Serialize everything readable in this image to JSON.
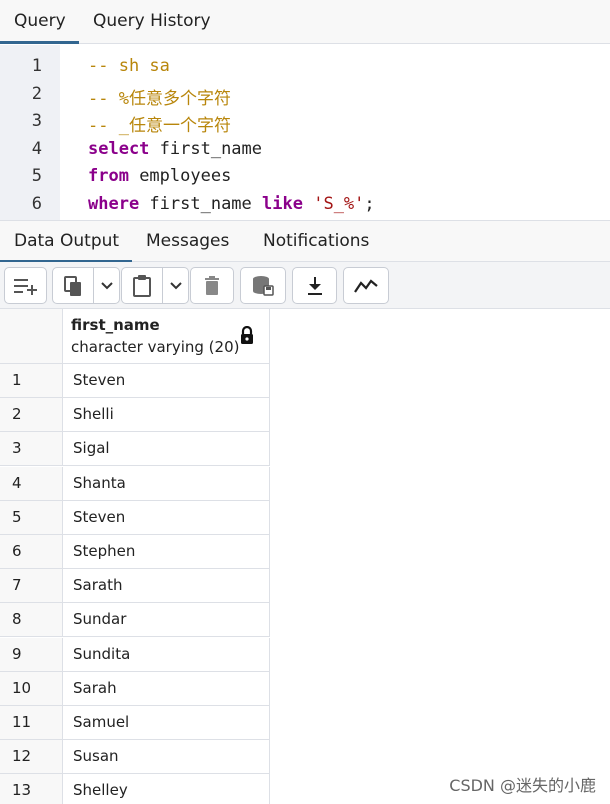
{
  "query_tabs": [
    "Query",
    "Query History"
  ],
  "editor": {
    "lines": [
      {
        "num": "1",
        "parts": [
          {
            "cls": "cm",
            "text": "-- sh sa"
          }
        ]
      },
      {
        "num": "2",
        "parts": [
          {
            "cls": "cm",
            "text": "-- %任意多个字符"
          }
        ]
      },
      {
        "num": "3",
        "parts": [
          {
            "cls": "cm",
            "text": "-- _任意一个字符"
          }
        ]
      },
      {
        "num": "4",
        "parts": [
          {
            "cls": "kw",
            "text": "select"
          },
          {
            "cls": "id",
            "text": " first_name"
          }
        ]
      },
      {
        "num": "5",
        "parts": [
          {
            "cls": "kw",
            "text": "from"
          },
          {
            "cls": "id",
            "text": " employees"
          }
        ]
      },
      {
        "num": "6",
        "parts": [
          {
            "cls": "kw",
            "text": "where"
          },
          {
            "cls": "id",
            "text": " first_name "
          },
          {
            "cls": "kw",
            "text": "like"
          },
          {
            "cls": "id",
            "text": " "
          },
          {
            "cls": "str",
            "text": "'S_%'"
          },
          {
            "cls": "id",
            "text": ";"
          }
        ]
      }
    ]
  },
  "output_tabs": [
    "Data Output",
    "Messages",
    "Notifications"
  ],
  "toolbar": {
    "icons": [
      "add-row-icon",
      "copy-icon",
      "chevron-down-icon",
      "paste-icon",
      "chevron-down-icon",
      "delete-icon",
      "save-data-icon",
      "download-icon",
      "graph-icon"
    ]
  },
  "grid": {
    "column_name": "first_name",
    "column_type": "character varying (20)",
    "rows": [
      {
        "n": "1",
        "v": "Steven"
      },
      {
        "n": "2",
        "v": "Shelli"
      },
      {
        "n": "3",
        "v": "Sigal"
      },
      {
        "n": "4",
        "v": "Shanta"
      },
      {
        "n": "5",
        "v": "Steven"
      },
      {
        "n": "6",
        "v": "Stephen"
      },
      {
        "n": "7",
        "v": "Sarath"
      },
      {
        "n": "8",
        "v": "Sundar"
      },
      {
        "n": "9",
        "v": "Sundita"
      },
      {
        "n": "10",
        "v": "Sarah"
      },
      {
        "n": "11",
        "v": "Samuel"
      },
      {
        "n": "12",
        "v": "Susan"
      },
      {
        "n": "13",
        "v": "Shelley"
      }
    ]
  },
  "watermark": "CSDN @迷失的小鹿",
  "colors": {
    "accent": "#326690",
    "keyword": "#8b008b",
    "comment": "#b8860b",
    "string": "#a31515"
  }
}
